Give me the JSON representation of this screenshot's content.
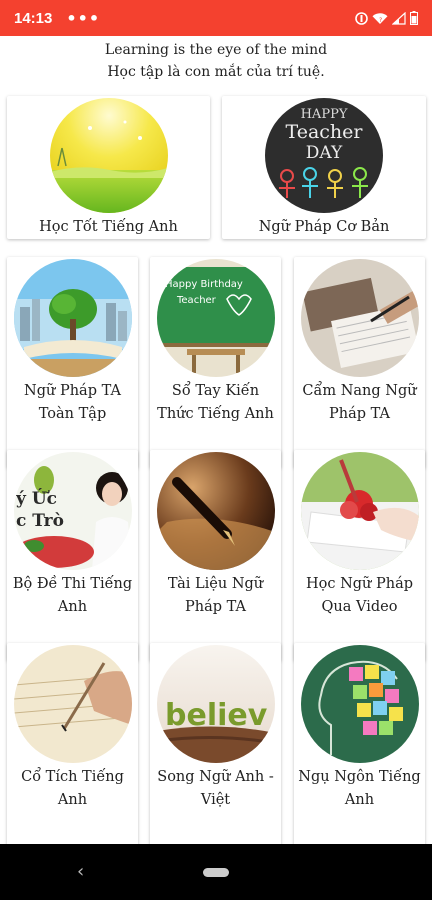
{
  "status_bar": {
    "time": "14:13",
    "overflow": "•••",
    "icons": [
      "do-not-disturb-icon",
      "wifi-icon",
      "signal-icon",
      "battery-icon"
    ],
    "color": "#f4412f"
  },
  "header": {
    "quote_en": "Learning is the eye of the mind",
    "quote_vi": "Học tập là con mắt của trí tuệ."
  },
  "cards": [
    {
      "label": "Học Tốt Tiếng Anh",
      "image": "meadow-sunlight-image"
    },
    {
      "label": "Ngữ Pháp Cơ Bản",
      "image": "chalkboard-teacher-day-image",
      "image_text": [
        "HAPPY",
        "Teacher",
        "DAY"
      ]
    },
    {
      "label": "Ngữ Pháp TA Toàn Tập",
      "image": "tree-on-book-city-image"
    },
    {
      "label": "Sổ Tay Kiến Thức Tiếng Anh",
      "image": "birthday-teacher-board-image",
      "image_text": [
        "Happy Birthday",
        "Teacher"
      ]
    },
    {
      "label": "Cẩm Nang Ngữ Pháp TA",
      "image": "notebooks-writing-image"
    },
    {
      "label": "Bộ Đề Thi Tiếng Anh",
      "image": "school-memories-girl-image",
      "image_text": [
        "ý Ức",
        "c Trò"
      ]
    },
    {
      "label": "Tài Liệu Ngữ Pháp TA",
      "image": "fountain-pen-writing-image"
    },
    {
      "label": "Học Ngữ Pháp Qua Video",
      "image": "hand-writing-red-flower-image"
    },
    {
      "label": "Cổ Tích Tiếng Anh",
      "image": "quill-pen-writing-image"
    },
    {
      "label": "Song Ngữ Anh - Việt",
      "image": "believe-word-image",
      "image_text": [
        "believ"
      ]
    },
    {
      "label": "Ngụ Ngôn Tiếng Anh",
      "image": "head-sticky-notes-image"
    }
  ],
  "nav_bar": {
    "back": "‹",
    "icons": [
      "back-icon",
      "home-pill-icon"
    ]
  }
}
